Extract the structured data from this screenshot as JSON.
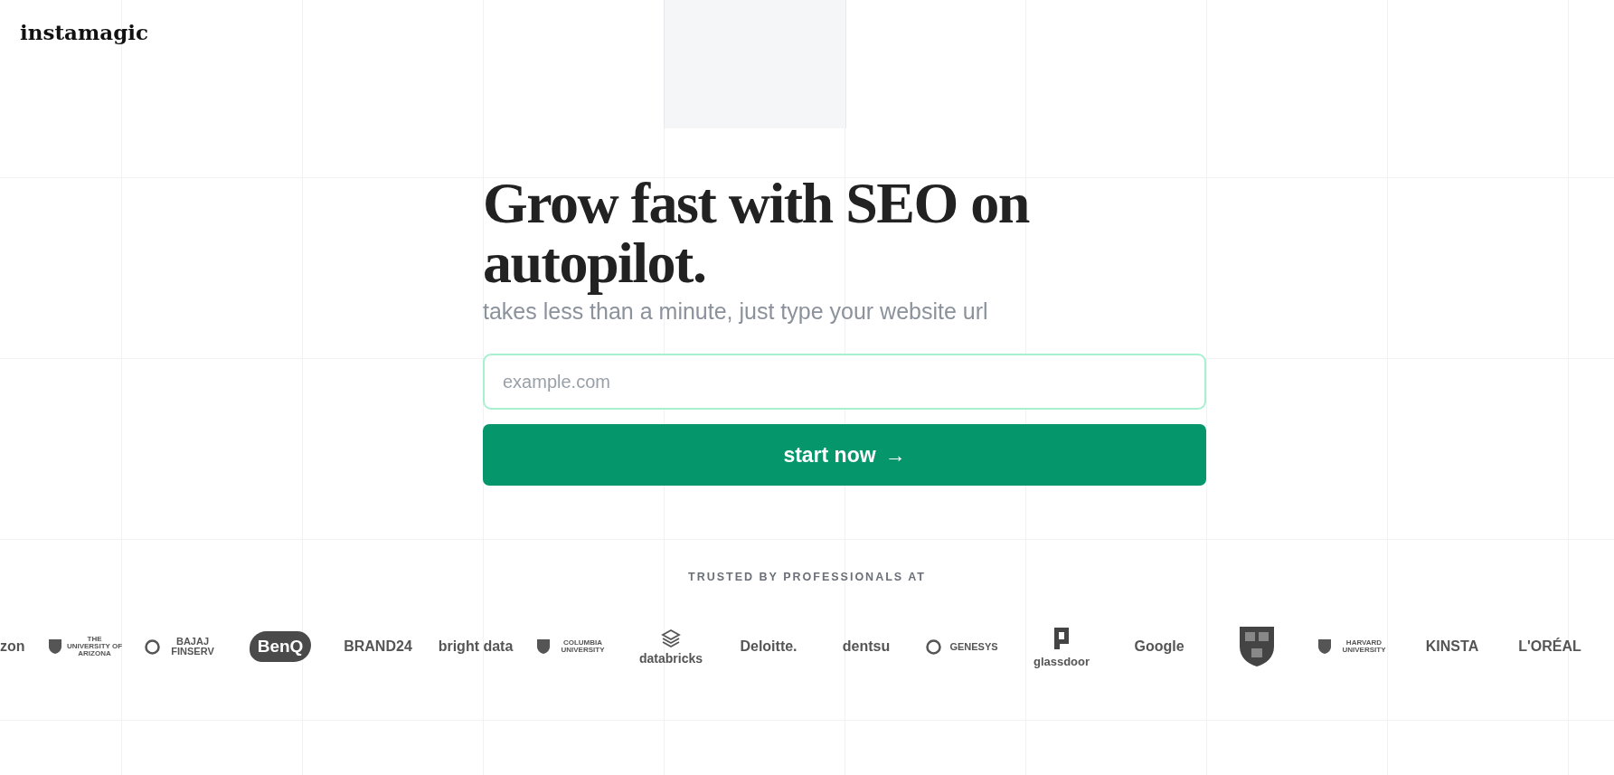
{
  "brand": "instamagic",
  "hero": {
    "title": "Grow fast with SEO on autopilot.",
    "subtitle": "takes less than a minute, just type your website url"
  },
  "url_field": {
    "placeholder": "example.com"
  },
  "start_button": {
    "label": "start now",
    "arrow": "→"
  },
  "trusted": {
    "heading": "TRUSTED BY PROFESSIONALS AT",
    "logos": [
      {
        "text": "zon",
        "kind": "wordmark"
      },
      {
        "text": "THE UNIVERSITY OF ARIZONA",
        "kind": "crest"
      },
      {
        "text": "BAJAJ FINSERV",
        "kind": "roundel"
      },
      {
        "text": "BenQ",
        "kind": "badge"
      },
      {
        "text": "BRAND24",
        "kind": "wordmark"
      },
      {
        "text": "bright data",
        "kind": "wordmark"
      },
      {
        "text": "COLUMBIA UNIVERSITY",
        "kind": "crest"
      },
      {
        "text": "databricks",
        "kind": "stack"
      },
      {
        "text": "Deloitte.",
        "kind": "wordmark"
      },
      {
        "text": "dentsu",
        "kind": "wordmark"
      },
      {
        "text": "GENESYS",
        "kind": "roundel"
      },
      {
        "text": "glassdoor",
        "kind": "tile"
      },
      {
        "text": "Google",
        "kind": "wordmark"
      },
      {
        "kind": "emblem"
      },
      {
        "text": "HARVARD UNIVERSITY",
        "kind": "crest"
      },
      {
        "text": "KINSTA",
        "kind": "wordmark"
      },
      {
        "text": "L'ORÉAL",
        "kind": "wordmark"
      }
    ]
  }
}
